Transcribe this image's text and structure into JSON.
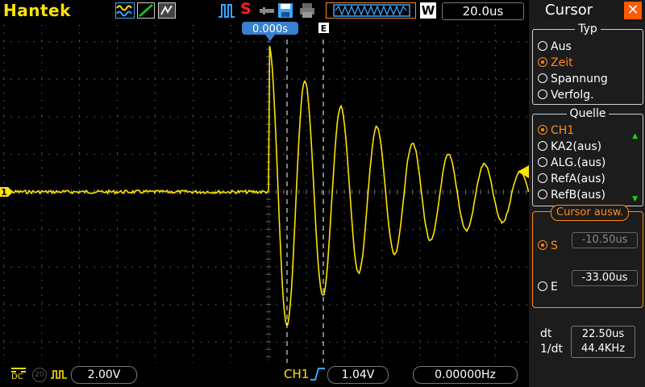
{
  "brand": "Hantek",
  "toolbar": {
    "icons": [
      "waveform-math-icon",
      "line-display-icon",
      "persistence-icon",
      "pulse-icon",
      "stop-icon",
      "save-icon",
      "print-icon",
      "memory-depth-icon",
      "w-icon"
    ],
    "run_state": "S",
    "w_label": "W",
    "timebase": "20.0us",
    "colors": {
      "brand": "#ffe400",
      "run_state": "#ff2020",
      "accent_blue": "#3aa7ff"
    }
  },
  "scope": {
    "trigger_time": "0.000s",
    "cursor_end_marker": "E",
    "channel_marker": "1",
    "trace_color": "#ffe400",
    "cursor_color": "#ffffff"
  },
  "bottom": {
    "dc_label": "DC",
    "bandwidth_label": "20",
    "volts_div": "2.00V",
    "trigger_channel": "CH1",
    "trigger_level": "1.04V",
    "frequency": "0.00000Hz"
  },
  "panel": {
    "title": "Cursor",
    "type_group": {
      "title": "Typ",
      "options": [
        "Aus",
        "Zeit",
        "Spannung",
        "Verfolg."
      ],
      "selected": "Zeit"
    },
    "source_group": {
      "title": "Quelle",
      "options": [
        "CH1",
        "KA2(aus)",
        "ALG.(aus)",
        "RefA(aus)",
        "RefB(aus)"
      ],
      "selected": "CH1"
    },
    "cursor_select": {
      "title": "Cursor  ausw.",
      "s_label": "S",
      "s_value": "-10.50us",
      "e_label": "E",
      "e_value": "-33.00us",
      "selected": "S"
    },
    "readout": {
      "dt_label": "dt",
      "dt_value": "22.50us",
      "inv_dt_label": "1/dt",
      "inv_dt_value": "44.4KHz"
    }
  }
}
